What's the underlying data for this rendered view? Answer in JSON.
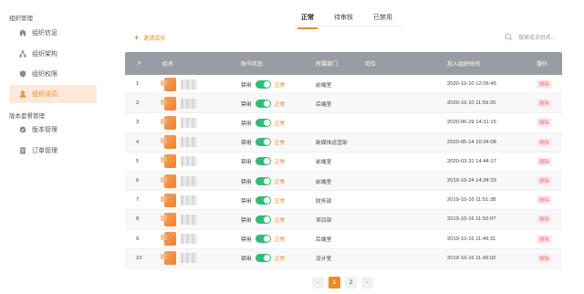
{
  "sidebar": {
    "group1_title": "组织管理",
    "items": [
      {
        "label": "组织信息",
        "icon": "building-icon"
      },
      {
        "label": "组织架构",
        "icon": "org-chart-icon"
      },
      {
        "label": "组织权限",
        "icon": "shield-icon"
      },
      {
        "label": "组织成员",
        "icon": "user-icon",
        "active": true
      }
    ],
    "group2_title": "版本套餐管理",
    "items2": [
      {
        "label": "版本管理",
        "icon": "version-icon"
      },
      {
        "label": "订单管理",
        "icon": "order-icon"
      }
    ]
  },
  "tabs": [
    {
      "label": "正常",
      "active": true
    },
    {
      "label": "待审核"
    },
    {
      "label": "已禁用"
    }
  ],
  "toolbar": {
    "add_label": "邀请成员",
    "search_placeholder": "搜索成员姓名..."
  },
  "table": {
    "headers": [
      "#",
      "姓名",
      "账号状态",
      "所属部门",
      "岗位",
      "加入组织时间",
      "操作"
    ],
    "status_off_label": "禁用",
    "status_on_label": "正常",
    "action_label": "删除",
    "rows": [
      {
        "no": "1",
        "dept": "前端室",
        "position": "",
        "joined": "2020-10-10 12:06:45"
      },
      {
        "no": "2",
        "dept": "后端室",
        "position": "",
        "joined": "2020-10-10 11:59:26"
      },
      {
        "no": "3",
        "dept": "",
        "position": "",
        "joined": "2020-06-29 14:31:15"
      },
      {
        "no": "4",
        "dept": "新媒体运营部",
        "position": "",
        "joined": "2020-05-14 10:34:08"
      },
      {
        "no": "5",
        "dept": "前端室",
        "position": "",
        "joined": "2020-03-31 14:44:17"
      },
      {
        "no": "6",
        "dept": "前端室",
        "position": "",
        "joined": "2019-10-24 14:34:33"
      },
      {
        "no": "7",
        "dept": "财务部",
        "position": "",
        "joined": "2019-10-16 11:51:38"
      },
      {
        "no": "8",
        "dept": "项目部",
        "position": "",
        "joined": "2019-10-16 11:50:07"
      },
      {
        "no": "9",
        "dept": "后端室",
        "position": "",
        "joined": "2019-10-16 11:49:31"
      },
      {
        "no": "10",
        "dept": "设计室",
        "position": "",
        "joined": "2019-10-16 11:49:02"
      }
    ]
  },
  "pagination": {
    "prev": "‹",
    "pages": [
      "1",
      "2"
    ],
    "current": "1",
    "next": "›"
  },
  "colors": {
    "accent": "#f08a24",
    "toggle_on": "#2fbd76",
    "header_bg": "#9a9ca3",
    "danger": "#f56c6c"
  }
}
